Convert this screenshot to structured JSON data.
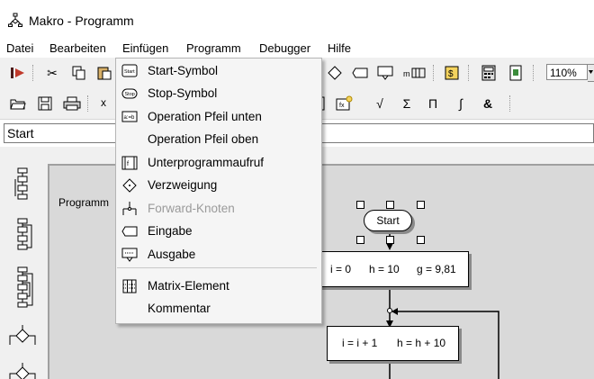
{
  "window": {
    "title": "Makro - Programm"
  },
  "menubar": [
    "Datei",
    "Bearbeiten",
    "Einfügen",
    "Programm",
    "Debugger",
    "Hilfe"
  ],
  "toolbar": {
    "zoom": "110%",
    "text_x": "x",
    "sqrt": "√",
    "sum": "Σ",
    "pi": "Π",
    "integral": "∫",
    "amp": "&"
  },
  "name_field": {
    "value": "Start"
  },
  "canvas": {
    "label": "Programm",
    "background": "#d9d9d9"
  },
  "flowchart": {
    "start": "Start",
    "box1": {
      "a": "i = 0",
      "b": "h = 10",
      "c": "g = 9,81"
    },
    "box2": {
      "a": "i = i + 1",
      "b": "h = h + 10"
    }
  },
  "dropdown": {
    "items": [
      {
        "label": "Start-Symbol",
        "icon": "start-symbol-icon",
        "enabled": true
      },
      {
        "label": "Stop-Symbol",
        "icon": "stop-symbol-icon",
        "enabled": true
      },
      {
        "label": "Operation Pfeil unten",
        "icon": "operation-icon",
        "enabled": true
      },
      {
        "label": "Operation Pfeil oben",
        "icon": "",
        "enabled": true
      },
      {
        "label": "Unterprogrammaufruf",
        "icon": "subprogram-icon",
        "enabled": true
      },
      {
        "label": "Verzweigung",
        "icon": "branch-icon",
        "enabled": true
      },
      {
        "label": "Forward-Knoten",
        "icon": "forward-node-icon",
        "enabled": false
      },
      {
        "label": "Eingabe",
        "icon": "input-icon",
        "enabled": true
      },
      {
        "label": "Ausgabe",
        "icon": "output-icon",
        "enabled": true
      },
      {
        "label": "Matrix-Element",
        "icon": "matrix-icon",
        "enabled": true
      },
      {
        "label": "Kommentar",
        "icon": "",
        "enabled": true
      }
    ]
  }
}
